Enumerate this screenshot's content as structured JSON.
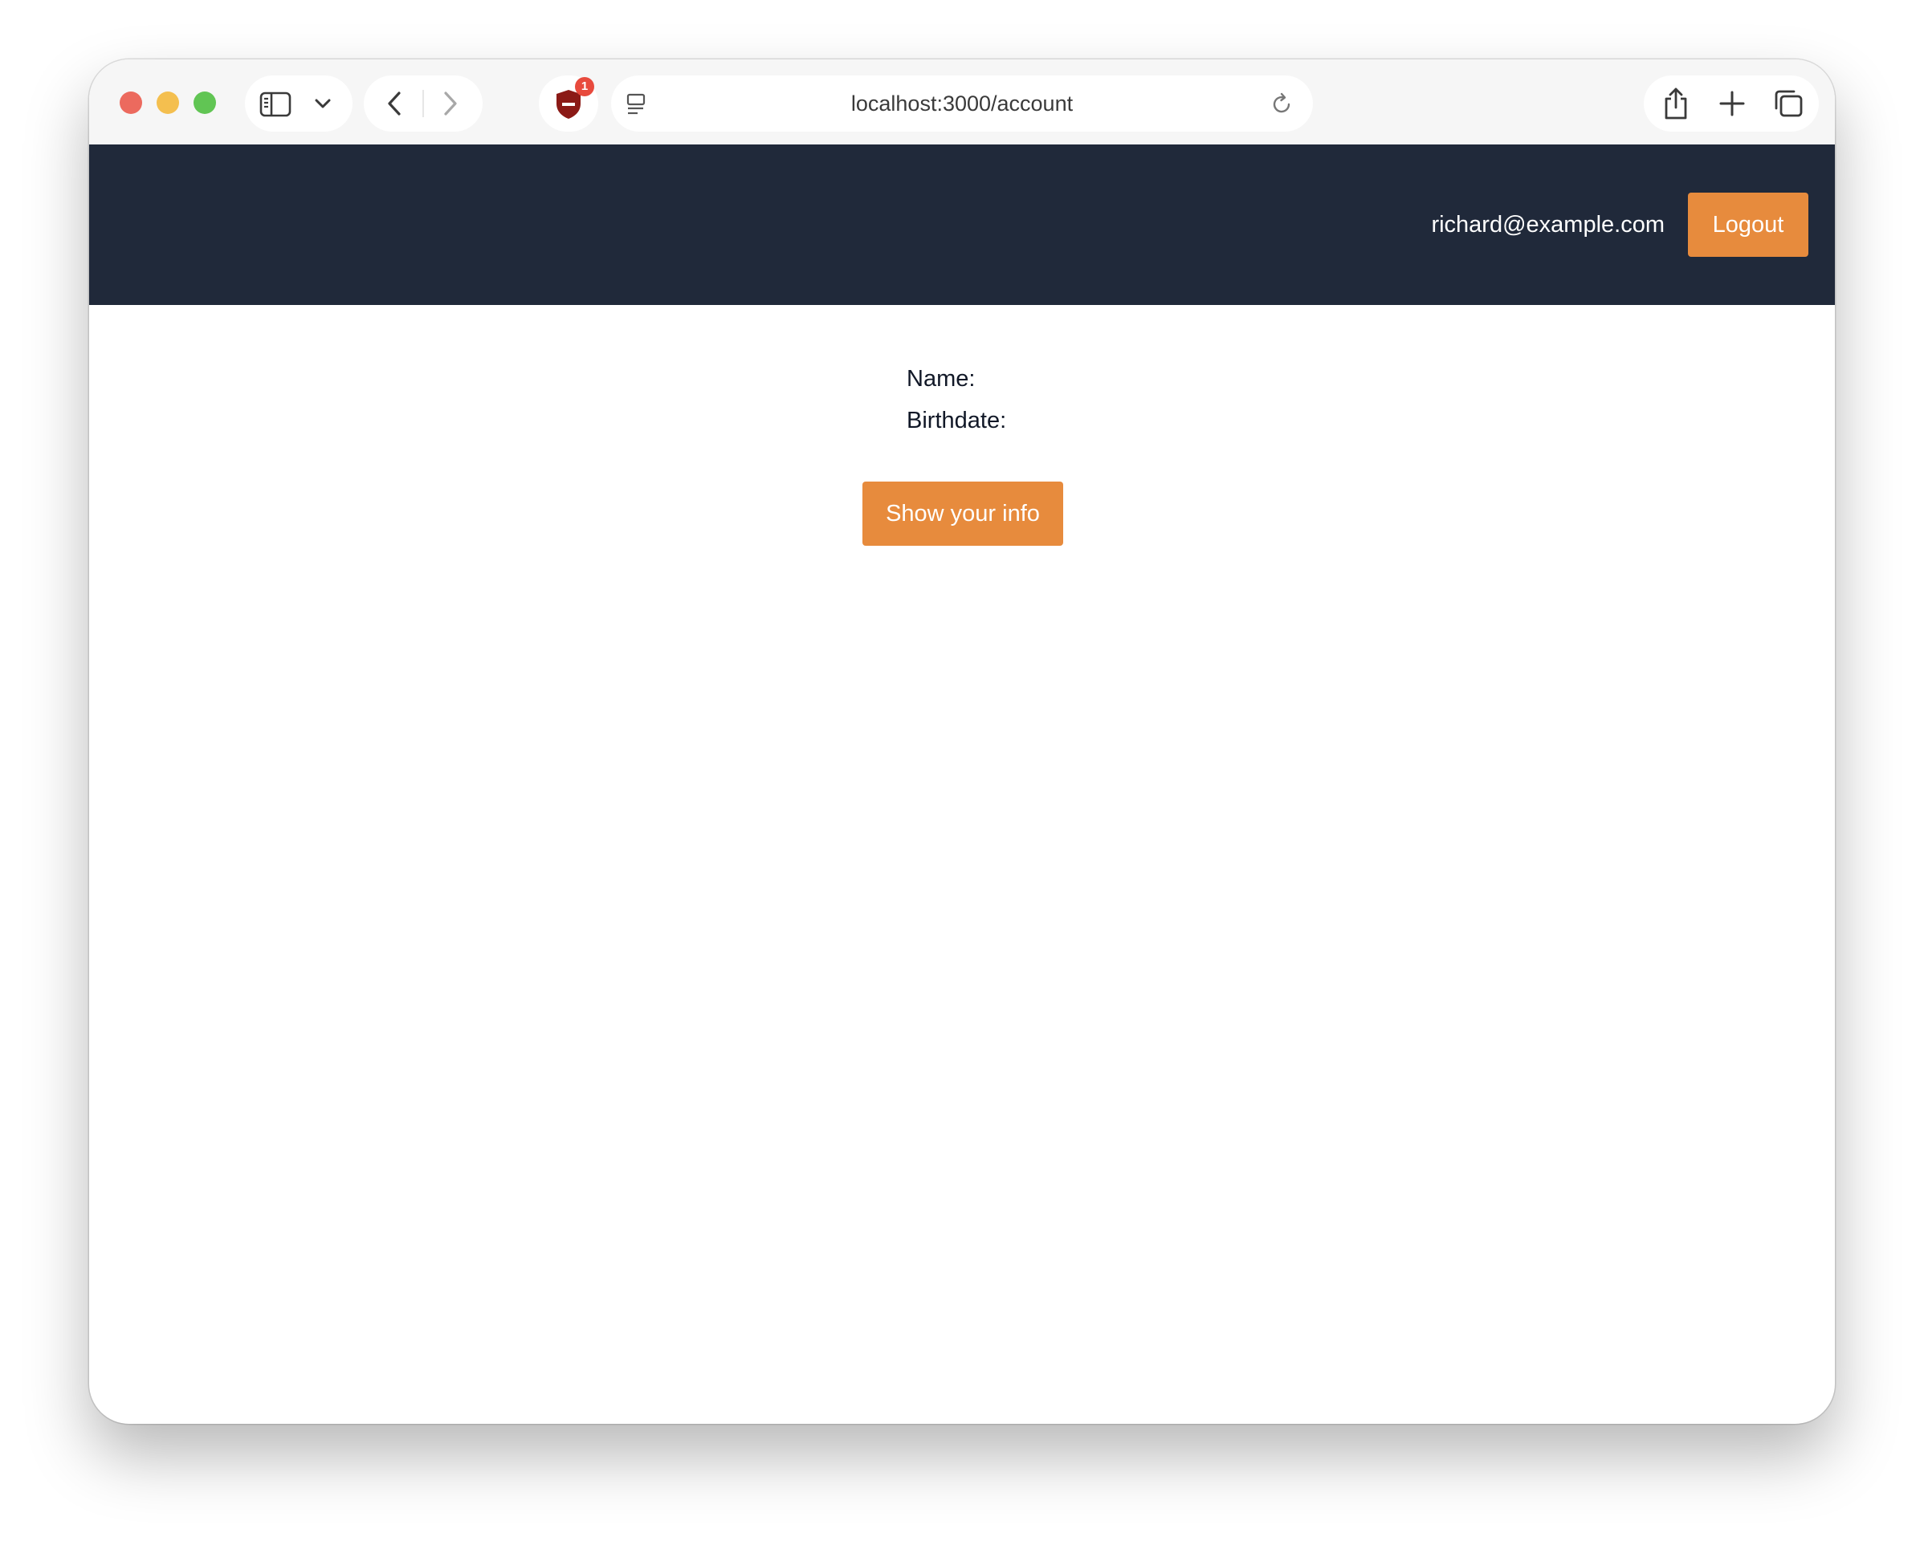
{
  "browser": {
    "url": "localhost:3000/account",
    "extension_badge_count": "1"
  },
  "header": {
    "user_email": "richard@example.com",
    "logout_label": "Logout"
  },
  "account": {
    "name_label": "Name:",
    "birthdate_label": "Birthdate:",
    "show_info_label": "Show your info"
  },
  "icons": {
    "sidebar": "sidebar-icon",
    "dropdown": "chevron-down-icon",
    "back": "chevron-left-icon",
    "forward": "chevron-right-icon",
    "extension": "shield-icon",
    "reader": "reader-icon",
    "reload": "reload-icon",
    "share": "share-icon",
    "new_tab": "plus-icon",
    "tabs": "tabs-overview-icon"
  },
  "colors": {
    "navbar_bg": "#20293a",
    "accent": "#e78b3d"
  }
}
